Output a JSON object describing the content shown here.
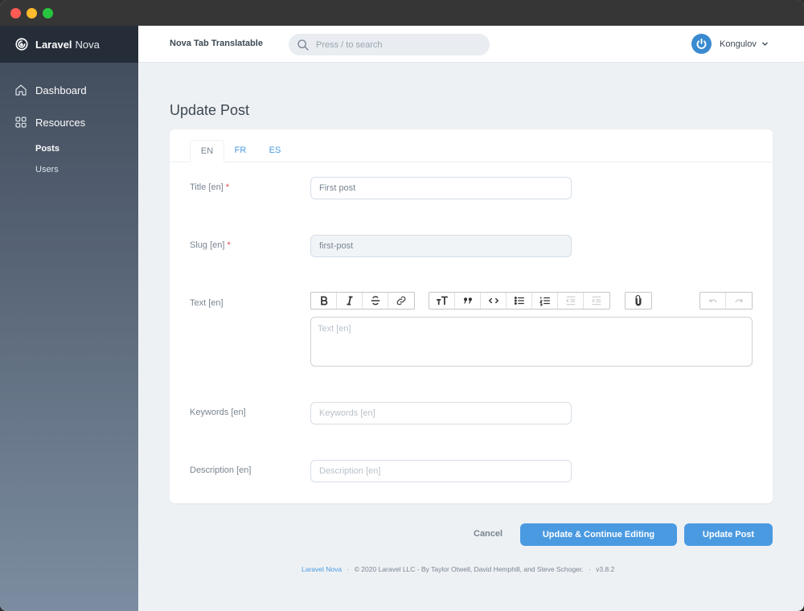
{
  "window": {
    "controls": [
      "close",
      "minimize",
      "zoom"
    ]
  },
  "brand": {
    "name_bold": "Laravel",
    "name_light": "Nova",
    "icon": "nova-swirl-icon"
  },
  "sidebar": {
    "items": [
      {
        "label": "Dashboard",
        "icon": "home-icon"
      },
      {
        "label": "Resources",
        "icon": "grid-icon"
      }
    ],
    "resources": [
      {
        "label": "Posts",
        "active": true
      },
      {
        "label": "Users",
        "active": false
      }
    ]
  },
  "header": {
    "app_title": "Nova Tab Translatable",
    "search_placeholder": "Press / to search",
    "user_name": "Kongulov"
  },
  "page": {
    "title": "Update Post",
    "tabs": [
      {
        "label": "EN",
        "active": true
      },
      {
        "label": "FR",
        "active": false
      },
      {
        "label": "ES",
        "active": false
      }
    ],
    "fields": {
      "title": {
        "label": "Title [en]",
        "required": "*",
        "value": "First post"
      },
      "slug": {
        "label": "Slug [en]",
        "required": "*",
        "value": "first-post"
      },
      "text": {
        "label": "Text [en]",
        "placeholder": "Text [en]"
      },
      "keywords": {
        "label": "Keywords [en]",
        "placeholder": "Keywords [en]"
      },
      "description": {
        "label": "Description [en]",
        "placeholder": "Description [en]"
      }
    },
    "toolbar": {
      "text_group": [
        "bold",
        "italic",
        "strikethrough",
        "link"
      ],
      "block_group": [
        "heading",
        "quote",
        "code",
        "bullet-list",
        "numbered-list",
        "decrease-indent",
        "increase-indent"
      ],
      "attach_group": [
        "attach"
      ],
      "history_group": [
        "undo",
        "redo"
      ]
    }
  },
  "actions": {
    "cancel": "Cancel",
    "update_continue": "Update & Continue Editing",
    "update": "Update Post"
  },
  "footer": {
    "link": "Laravel Nova",
    "sep": "·",
    "copyright": "© 2020 Laravel LLC - By Taylor Otwell, David Hemphill, and Steve Schoger.",
    "version": "v3.8.2"
  },
  "colors": {
    "accent": "#4a9ae1",
    "sidebar_top": "#3f4959",
    "sidebar_bottom": "#7c8da1",
    "required": "#e74444"
  }
}
